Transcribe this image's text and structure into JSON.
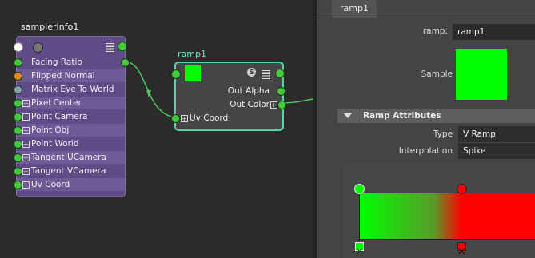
{
  "colors": {
    "graph_bg": "#2b2b2b",
    "sampler_node": "#5f4c86",
    "ramp_node_border": "#57d4a2",
    "port_green": "#44c83c",
    "swatch_green": "#00ff00",
    "ramp_red": "#ff0000",
    "panel_bg": "#444444"
  },
  "graph": {
    "sampler_node": {
      "title": "samplerInfo1",
      "attributes": [
        {
          "label": "Facing Ratio",
          "expandable": false,
          "port": "green"
        },
        {
          "label": "Flipped Normal",
          "expandable": false,
          "port": "orange"
        },
        {
          "label": "Matrix Eye To World",
          "expandable": false,
          "port": "grey"
        },
        {
          "label": "Pixel Center",
          "expandable": true,
          "port": "green"
        },
        {
          "label": "Point Camera",
          "expandable": true,
          "port": "green"
        },
        {
          "label": "Point Obj",
          "expandable": true,
          "port": "green"
        },
        {
          "label": "Point World",
          "expandable": true,
          "port": "green"
        },
        {
          "label": "Tangent UCamera",
          "expandable": true,
          "port": "green"
        },
        {
          "label": "Tangent VCamera",
          "expandable": true,
          "port": "green"
        },
        {
          "label": "Uv Coord",
          "expandable": true,
          "port": "green"
        }
      ]
    },
    "ramp_node": {
      "title": "ramp1",
      "out_alpha": "Out Alpha",
      "out_color": "Out Color",
      "uv_coord": "Uv Coord"
    }
  },
  "attribute_editor": {
    "tab_label": "ramp1",
    "ramp_field_label": "ramp:",
    "ramp_field_value": "ramp1",
    "sample_label": "Sample",
    "section_title": "Ramp Attributes",
    "type_label": "Type",
    "type_value": "V Ramp",
    "interpolation_label": "Interpolation",
    "interpolation_value": "Spike",
    "ramp_colors": [
      "#00ff00",
      "#ff0000"
    ]
  }
}
